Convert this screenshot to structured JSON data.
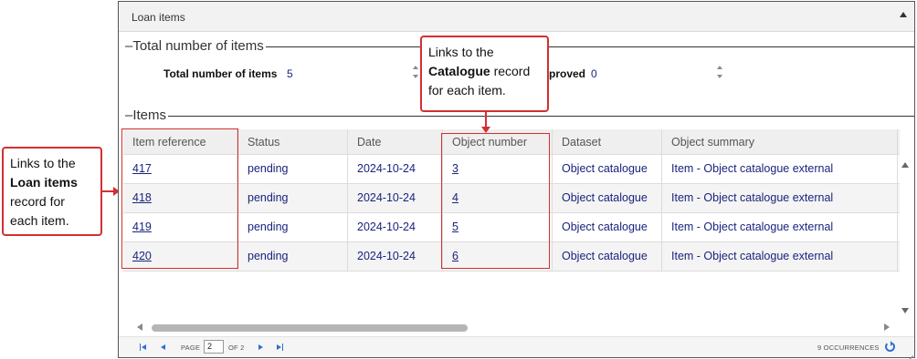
{
  "panel": {
    "title": "Loan items"
  },
  "totals_section": {
    "legend": "Total number of items",
    "total_label": "Total number of items",
    "total_value": "5",
    "approved_label_partial": "proved",
    "approved_value": "0"
  },
  "items_section": {
    "legend": "Items"
  },
  "grid": {
    "columns": [
      "Item reference",
      "Status",
      "Date",
      "Object number",
      "Dataset",
      "Object summary"
    ],
    "rows": [
      {
        "ref": "417",
        "status": "pending",
        "date": "2024-10-24",
        "object_number": "3",
        "dataset": "Object catalogue",
        "summary": "Item - Object catalogue external"
      },
      {
        "ref": "418",
        "status": "pending",
        "date": "2024-10-24",
        "object_number": "4",
        "dataset": "Object catalogue",
        "summary": "Item - Object catalogue external"
      },
      {
        "ref": "419",
        "status": "pending",
        "date": "2024-10-24",
        "object_number": "5",
        "dataset": "Object catalogue",
        "summary": "Item - Object catalogue external"
      },
      {
        "ref": "420",
        "status": "pending",
        "date": "2024-10-24",
        "object_number": "6",
        "dataset": "Object catalogue",
        "summary": "Item - Object catalogue external"
      }
    ]
  },
  "pager": {
    "page_label": "PAGE",
    "page_value": "2",
    "of_label": "OF 2",
    "occurrences": "9 OCCURRENCES"
  },
  "callouts": {
    "left": {
      "line1": "Links to the",
      "bold": "Loan items",
      "line3": "record for",
      "line4": "each item."
    },
    "top": {
      "line1": "Links to the",
      "bold": "Catalogue",
      "rest": " record",
      "line3": "for each item."
    }
  },
  "colors": {
    "accent_red": "#d32f2f",
    "link_blue": "#1a237e",
    "pager_blue": "#2e6fd2"
  }
}
